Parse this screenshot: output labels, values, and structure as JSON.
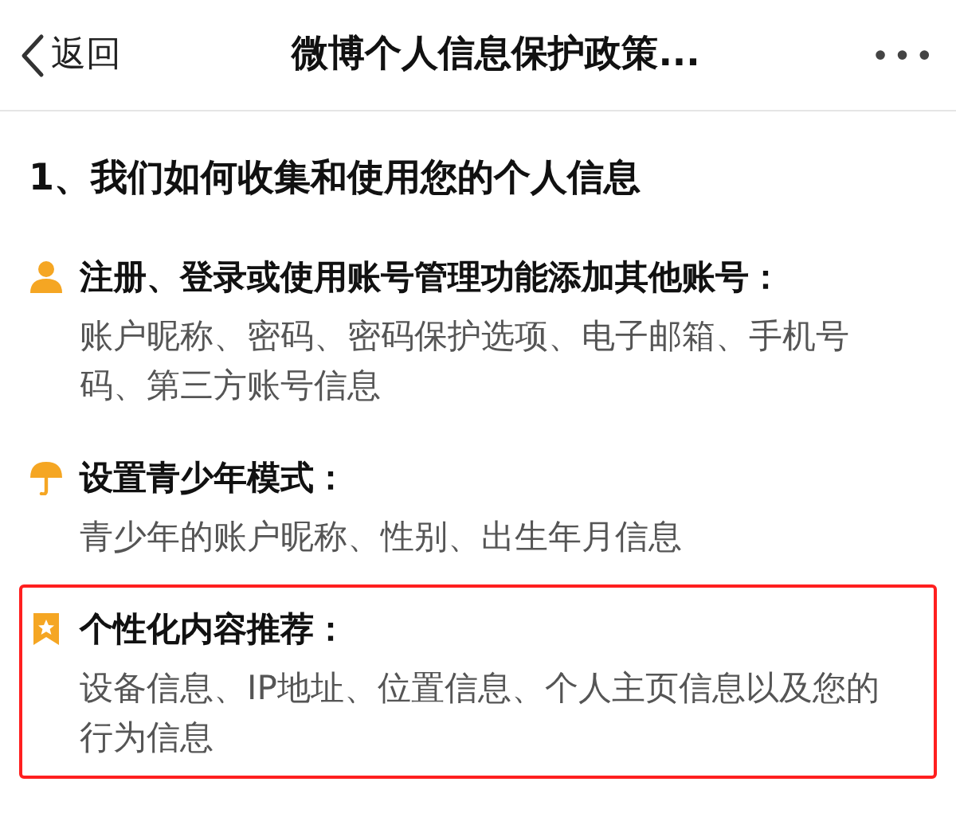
{
  "header": {
    "back": "返回",
    "title": "微博个人信息保护政策...",
    "more": "•••"
  },
  "section": {
    "title": "1、我们如何收集和使用您的个人信息",
    "items": [
      {
        "kind": "person",
        "title": "注册、登录或使用账号管理功能添加其他账号：",
        "description": "账户昵称、密码、密码保护选项、电子邮箱、手机号码、第三方账号信息",
        "highlighted": false
      },
      {
        "kind": "umbrella",
        "title": "设置青少年模式：",
        "description": "青少年的账户昵称、性别、出生年月信息",
        "highlighted": false
      },
      {
        "kind": "bookmark",
        "title": "个性化内容推荐：",
        "description": "设备信息、IP地址、位置信息、个人主页信息以及您的行为信息",
        "highlighted": true
      }
    ]
  }
}
